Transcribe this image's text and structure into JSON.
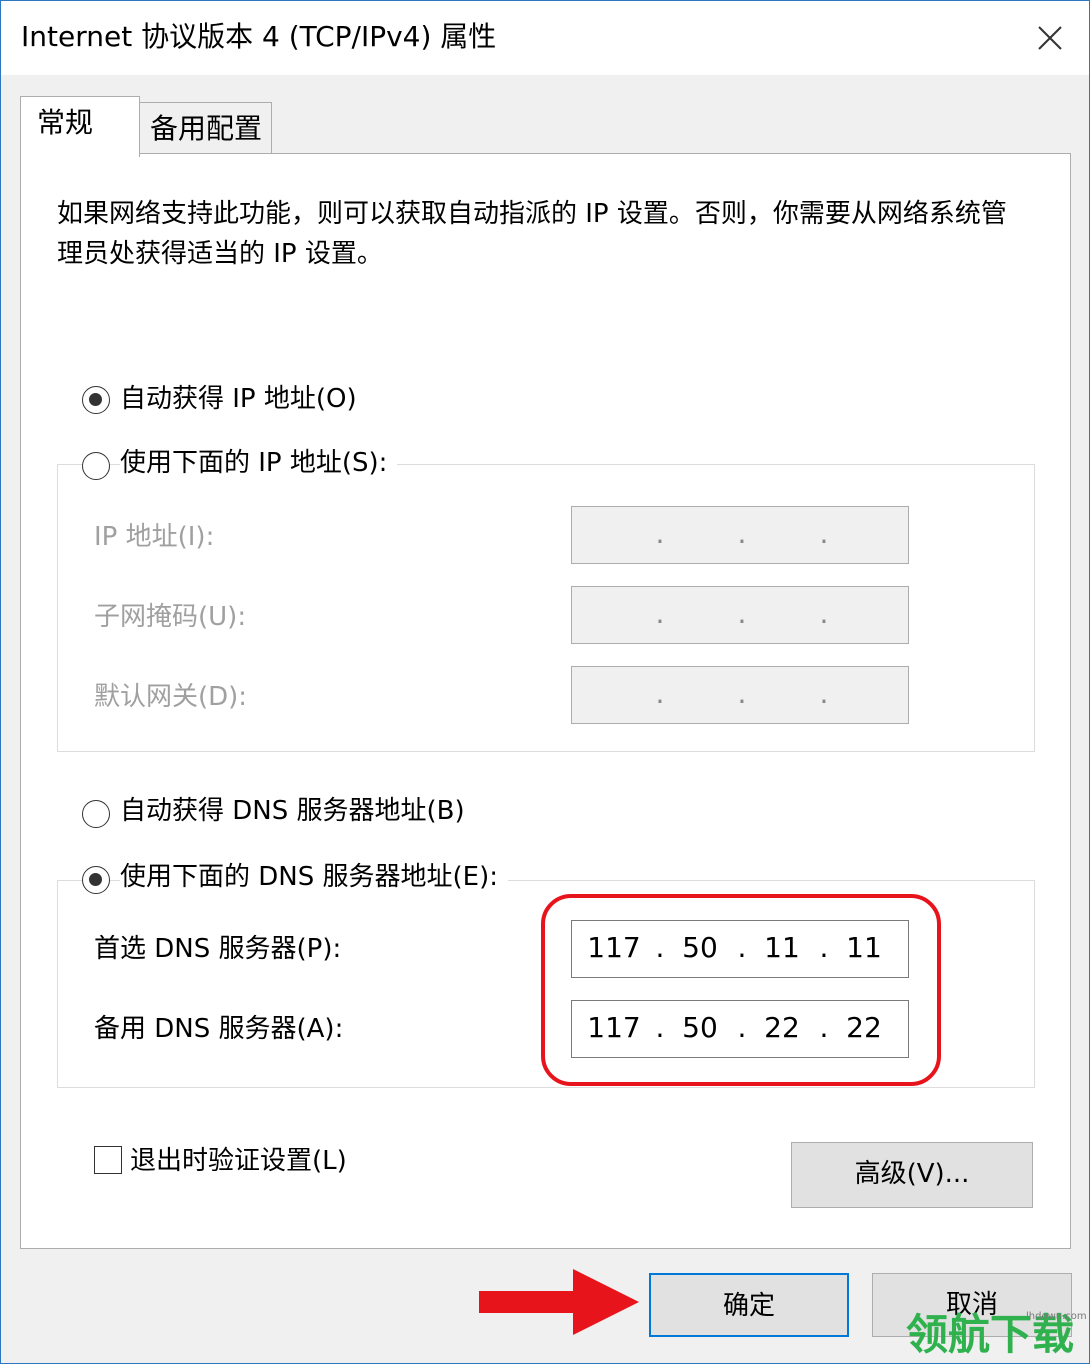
{
  "window": {
    "title": "Internet 协议版本 4 (TCP/IPv4) 属性"
  },
  "tabs": [
    {
      "label": "常规"
    },
    {
      "label": "备用配置"
    }
  ],
  "description": "如果网络支持此功能，则可以获取自动指派的 IP 设置。否则，你需要从网络系统管理员处获得适当的 IP 设置。",
  "ip": {
    "auto_label": "自动获得 IP 地址(O)",
    "auto_selected": true,
    "manual_label": "使用下面的 IP 地址(S):",
    "fields": [
      {
        "label": "IP 地址(I):",
        "value": ". . ."
      },
      {
        "label": "子网掩码(U):",
        "value": ". . ."
      },
      {
        "label": "默认网关(D):",
        "value": ". . ."
      }
    ]
  },
  "dns": {
    "auto_label": "自动获得 DNS 服务器地址(B)",
    "manual_label": "使用下面的 DNS 服务器地址(E):",
    "manual_selected": true,
    "preferred": {
      "label": "首选 DNS 服务器(P):",
      "octets": [
        "117",
        "50",
        "11",
        "11"
      ]
    },
    "alternate": {
      "label": "备用 DNS 服务器(A):",
      "octets": [
        "117",
        "50",
        "22",
        "22"
      ]
    }
  },
  "validate_label": "退出时验证设置(L)",
  "buttons": {
    "advanced": "高级(V)...",
    "ok": "确定",
    "cancel": "取消"
  },
  "watermark": {
    "text": "领航下载",
    "url": "lhdown.com"
  },
  "colors": {
    "highlight": "#e8141c",
    "arrow": "#e8141c",
    "ok_border": "#0078d7",
    "watermark": "#2fb14e"
  }
}
